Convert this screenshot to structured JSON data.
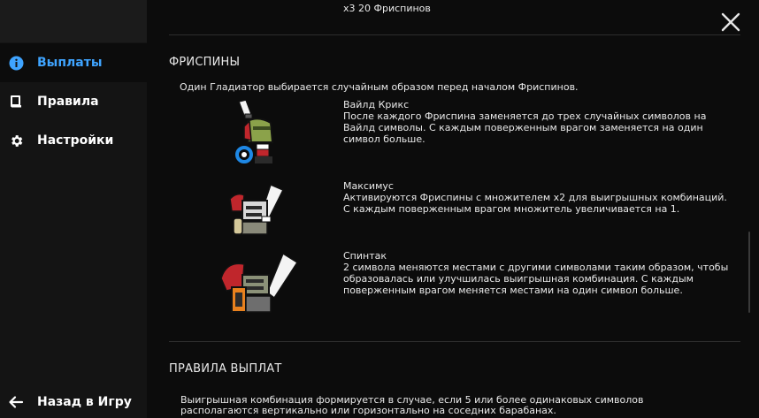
{
  "sidebar": {
    "items": [
      {
        "label": "Выплаты",
        "icon": "info-icon",
        "active": true
      },
      {
        "label": "Правила",
        "icon": "book-icon",
        "active": false
      },
      {
        "label": "Настройки",
        "icon": "gear-icon",
        "active": false
      }
    ],
    "back_label": "Назад в Игру",
    "accent": "#3fa4ff"
  },
  "main": {
    "top_text": "х3 20 Фриспинов",
    "freespins": {
      "title": "ФРИСПИНЫ",
      "intro": "Один Гладиатор выбирается случайным образом перед началом Фриспинов.",
      "features": [
        {
          "name": "Вайлд Крикс",
          "description": "После каждого Фриспина заменяется до трех случайных символов на Вайлд символы. С каждым поверженным врагом заменяется на один символ больше."
        },
        {
          "name": "Максимус",
          "description": "Активируются Фриспины с множителем x2 для выигрышных комбинаций. С каждым поверженным врагом множитель увеличивается на 1."
        },
        {
          "name": "Спинтак",
          "description": "2 символа меняются местами с другими символами таким образом, чтобы образовалась или улучшилась выигрышная комбинация. С каждым поверженным врагом меняется местами на один символ больше."
        }
      ]
    },
    "payout_rules": {
      "title": "ПРАВИЛА ВЫПЛАТ",
      "text": "Выигрышная комбинация формируется в случае, если 5 или более одинаковых символов располагаются вертикально или горизонтально на соседних барабанах."
    }
  }
}
